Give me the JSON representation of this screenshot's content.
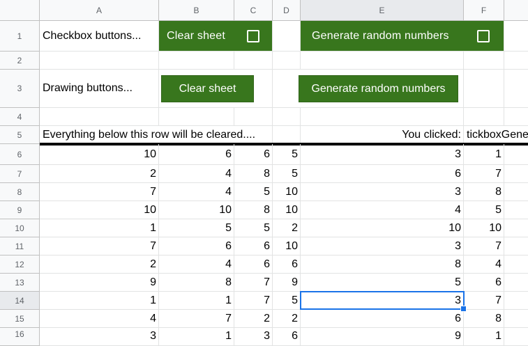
{
  "columns": [
    "A",
    "B",
    "C",
    "D",
    "E",
    "F"
  ],
  "rows": [
    "1",
    "2",
    "3",
    "4",
    "5",
    "6",
    "7",
    "8",
    "9",
    "10",
    "11",
    "12",
    "13",
    "14",
    "15",
    "16"
  ],
  "row1": {
    "label": "Checkbox buttons...",
    "clear_label": "Clear sheet",
    "generate_label": "Generate random numbers"
  },
  "row3": {
    "label": "Drawing buttons...",
    "clear_button": "Clear sheet",
    "generate_button": "Generate random numbers"
  },
  "row5": {
    "note": "Everything below this row will be cleared....",
    "you_clicked_label": "You clicked:",
    "you_clicked_value": "tickboxGene"
  },
  "data_rows": [
    {
      "a": "10",
      "b": "6",
      "c": "6",
      "d": "5",
      "e": "3",
      "f": "1"
    },
    {
      "a": "2",
      "b": "4",
      "c": "8",
      "d": "5",
      "e": "6",
      "f": "7"
    },
    {
      "a": "7",
      "b": "4",
      "c": "5",
      "d": "10",
      "e": "3",
      "f": "8"
    },
    {
      "a": "10",
      "b": "10",
      "c": "8",
      "d": "10",
      "e": "4",
      "f": "5"
    },
    {
      "a": "1",
      "b": "5",
      "c": "5",
      "d": "2",
      "e": "10",
      "f": "10"
    },
    {
      "a": "7",
      "b": "6",
      "c": "6",
      "d": "10",
      "e": "3",
      "f": "7"
    },
    {
      "a": "2",
      "b": "4",
      "c": "6",
      "d": "6",
      "e": "8",
      "f": "4"
    },
    {
      "a": "9",
      "b": "8",
      "c": "7",
      "d": "9",
      "e": "5",
      "f": "6"
    },
    {
      "a": "1",
      "b": "1",
      "c": "7",
      "d": "5",
      "e": "3",
      "f": "7"
    },
    {
      "a": "4",
      "b": "7",
      "c": "2",
      "d": "2",
      "e": "6",
      "f": "8"
    },
    {
      "a": "3",
      "b": "1",
      "c": "3",
      "d": "6",
      "e": "9",
      "f": "1"
    }
  ],
  "colors": {
    "button_green": "#38761d",
    "selection_blue": "#1a73e8"
  },
  "selected_cell": "E14"
}
